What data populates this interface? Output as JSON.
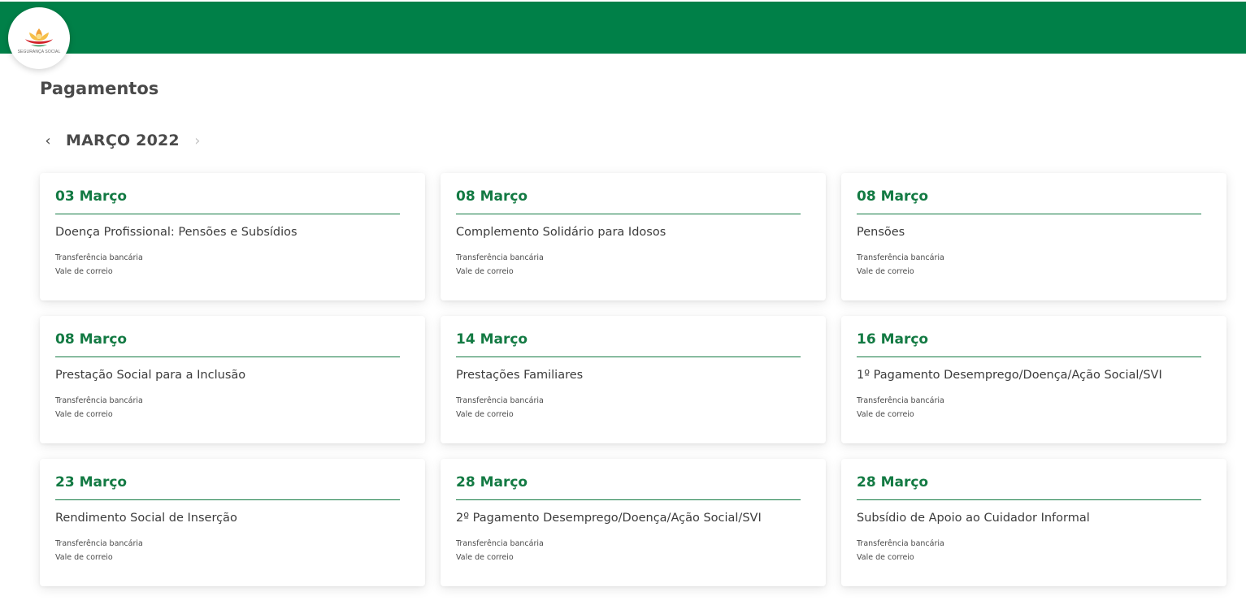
{
  "header": {
    "brand_color": "#008048",
    "logo_text": "Segurança Social",
    "logo_icon": "flower-logo-icon"
  },
  "page": {
    "title": "Pagamentos"
  },
  "month_nav": {
    "prev_icon": "chevron-left-icon",
    "next_icon": "chevron-right-icon",
    "prev_symbol": "‹",
    "next_symbol": "›",
    "label": "MARÇO 2022"
  },
  "accent_color": "#137a43",
  "payments": [
    {
      "date": "03 Março",
      "title": "Doença Profissional: Pensões e Subsídios",
      "methods": [
        "Transferência bancária",
        "Vale de correio"
      ]
    },
    {
      "date": "08 Março",
      "title": "Complemento Solidário para Idosos",
      "methods": [
        "Transferência bancária",
        "Vale de correio"
      ]
    },
    {
      "date": "08 Março",
      "title": "Pensões",
      "methods": [
        "Transferência bancária",
        "Vale de correio"
      ]
    },
    {
      "date": "08 Março",
      "title": "Prestação Social para a Inclusão",
      "methods": [
        "Transferência bancária",
        "Vale de correio"
      ]
    },
    {
      "date": "14 Março",
      "title": "Prestações Familiares",
      "methods": [
        "Transferência bancária",
        "Vale de correio"
      ]
    },
    {
      "date": "16 Março",
      "title": "1º Pagamento Desemprego/Doença/Ação Social/SVI",
      "methods": [
        "Transferência bancária",
        "Vale de correio"
      ]
    },
    {
      "date": "23 Março",
      "title": "Rendimento Social de Inserção",
      "methods": [
        "Transferência bancária",
        "Vale de correio"
      ]
    },
    {
      "date": "28 Março",
      "title": "2º Pagamento Desemprego/Doença/Ação Social/SVI",
      "methods": [
        "Transferência bancária",
        "Vale de correio"
      ]
    },
    {
      "date": "28 Março",
      "title": "Subsídio de Apoio ao Cuidador Informal",
      "methods": [
        "Transferência bancária",
        "Vale de correio"
      ]
    }
  ]
}
